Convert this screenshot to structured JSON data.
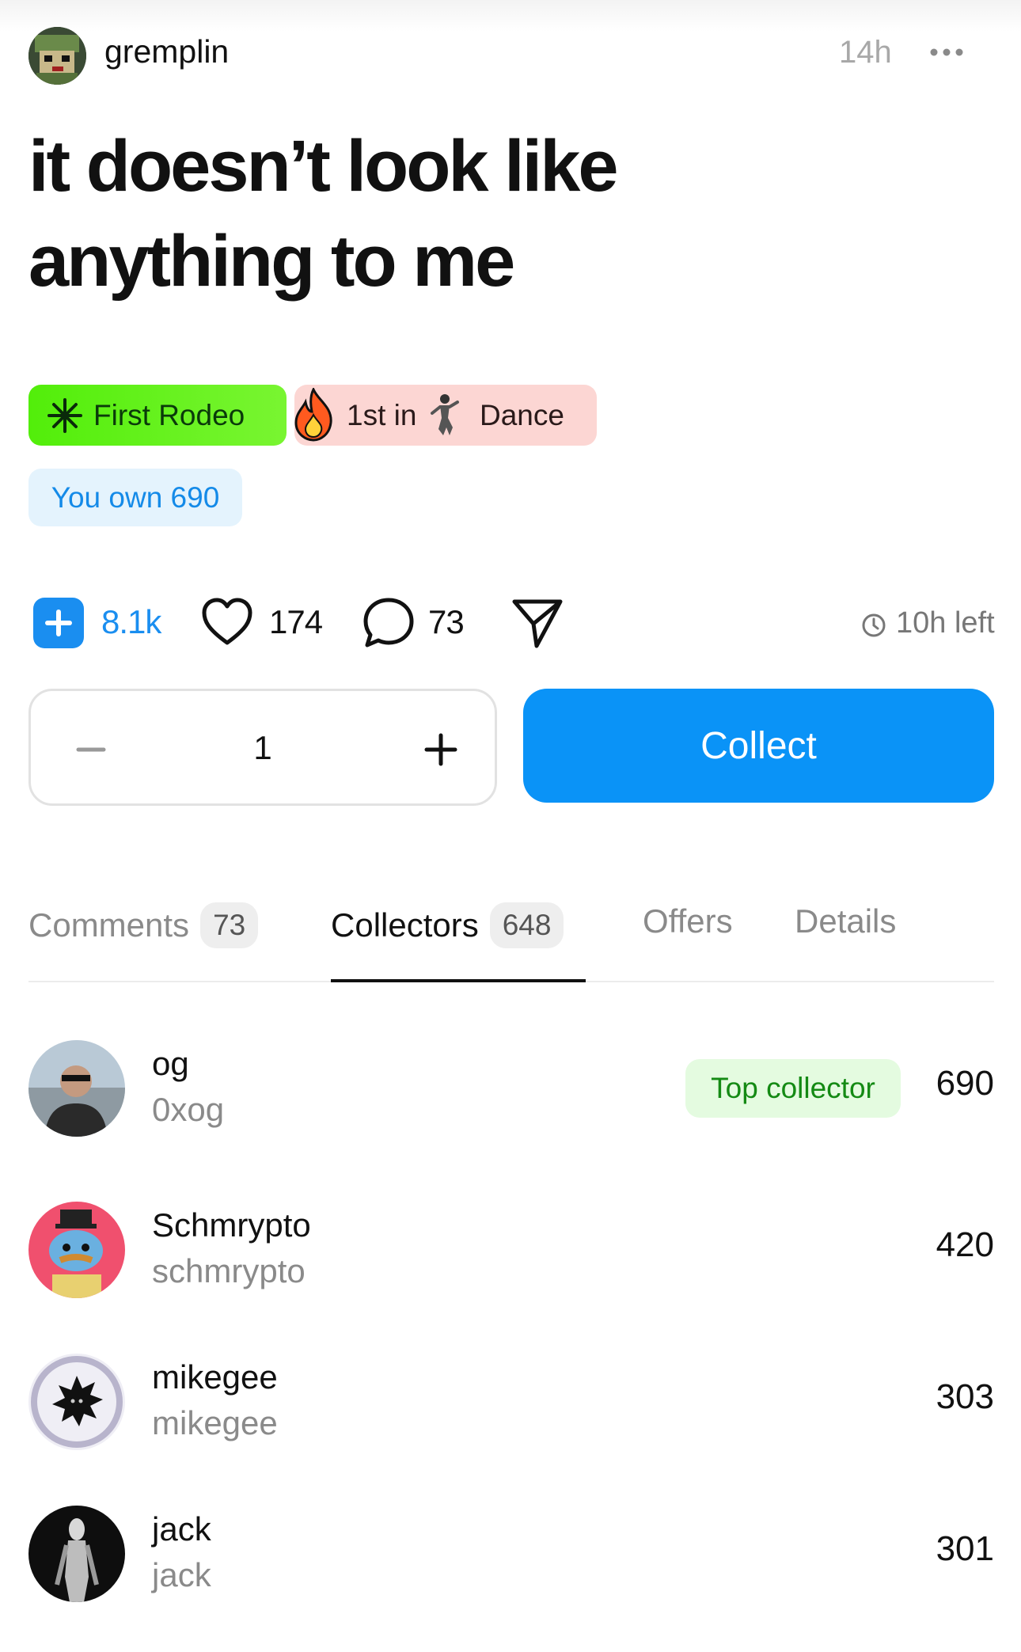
{
  "post": {
    "username": "gremplin",
    "time_ago": "14h",
    "title": "it doesn’t look like anything to me"
  },
  "badges": {
    "first_rodeo": "First Rodeo",
    "rank_prefix": "1st in",
    "rank_category": "Dance",
    "you_own": "You own 690"
  },
  "actions": {
    "collect_count": "8.1k",
    "like_count": "174",
    "comment_count": "73",
    "time_left": "10h left"
  },
  "stepper": {
    "quantity": "1"
  },
  "collect_button": "Collect",
  "tabs": [
    {
      "label": "Comments",
      "count": "73"
    },
    {
      "label": "Collectors",
      "count": "648"
    },
    {
      "label": "Offers"
    },
    {
      "label": "Details"
    }
  ],
  "collectors": [
    {
      "name": "og",
      "handle": "0xog",
      "amount": "690",
      "badge": "Top collector"
    },
    {
      "name": "Schmrypto",
      "handle": "schmrypto",
      "amount": "420"
    },
    {
      "name": "mikegee",
      "handle": "mikegee",
      "amount": "303"
    },
    {
      "name": "jack",
      "handle": "jack",
      "amount": "301"
    }
  ],
  "colors": {
    "accent_blue": "#0a93f7",
    "badge_green": "#52ee0a",
    "badge_red_bg": "#fcd6d3",
    "own_bg": "#e4f3fd",
    "top_collector_bg": "#e4fbe0"
  },
  "icons": [
    "more-icon",
    "asterisk-icon",
    "flame-icon",
    "dancer-icon",
    "plus-icon",
    "heart-icon",
    "comment-icon",
    "send-icon",
    "clock-icon",
    "minus-icon"
  ]
}
